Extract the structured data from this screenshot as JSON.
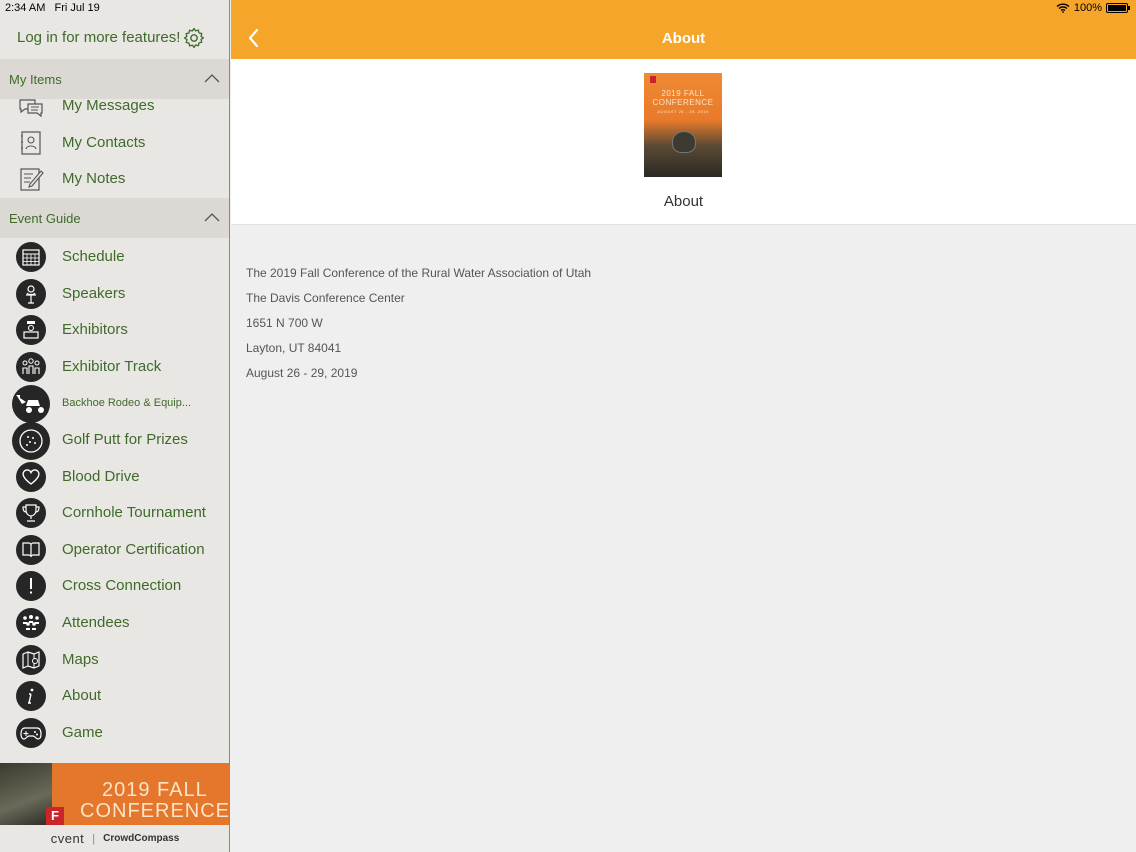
{
  "status_bar": {
    "time": "2:34 AM",
    "date": "Fri Jul 19",
    "battery": "100%"
  },
  "sidebar": {
    "login_text": "Log in for more features!",
    "sections": [
      {
        "title": "My Items",
        "items": [
          {
            "label": "My Messages",
            "icon": "messages-icon"
          },
          {
            "label": "My Contacts",
            "icon": "contacts-icon"
          },
          {
            "label": "My Notes",
            "icon": "notes-icon"
          }
        ]
      },
      {
        "title": "Event Guide",
        "items": [
          {
            "label": "Schedule",
            "icon": "calendar-icon"
          },
          {
            "label": "Speakers",
            "icon": "speaker-icon"
          },
          {
            "label": "Exhibitors",
            "icon": "exhibitor-icon"
          },
          {
            "label": "Exhibitor Track",
            "icon": "people-icon"
          },
          {
            "label": "Backhoe Rodeo & Equip...",
            "icon": "backhoe-icon"
          },
          {
            "label": "Golf Putt for Prizes",
            "icon": "golf-ball-icon"
          },
          {
            "label": "Blood Drive",
            "icon": "heart-icon"
          },
          {
            "label": "Cornhole Tournament",
            "icon": "trophy-icon"
          },
          {
            "label": "Operator Certification",
            "icon": "book-icon"
          },
          {
            "label": "Cross Connection",
            "icon": "exclamation-icon"
          },
          {
            "label": "Attendees",
            "icon": "group-icon"
          },
          {
            "label": "Maps",
            "icon": "map-icon"
          },
          {
            "label": "About",
            "icon": "info-icon"
          },
          {
            "label": "Game",
            "icon": "gamepad-icon"
          }
        ]
      }
    ],
    "banner": {
      "line1": "2019 FALL",
      "line2": "CONFERENCE"
    },
    "footer": {
      "brand1": "cvent",
      "separator": "|",
      "brand2": "CrowdCompass"
    }
  },
  "main": {
    "title": "About",
    "hero_label": "About",
    "thumbnail": {
      "line1": "2019 FALL",
      "line2": "CONFERENCE",
      "line3": "AUGUST 26 - 29, 2019"
    },
    "details": [
      "The 2019 Fall Conference of the Rural Water Association of Utah",
      "The Davis Conference Center",
      "1651 N 700 W",
      "Layton, UT 84041",
      "August 26 - 29, 2019"
    ]
  },
  "colors": {
    "accent": "#f5a52a",
    "sidebar_text": "#3f6a2a",
    "sidebar_bg": "#e9e7e3"
  }
}
